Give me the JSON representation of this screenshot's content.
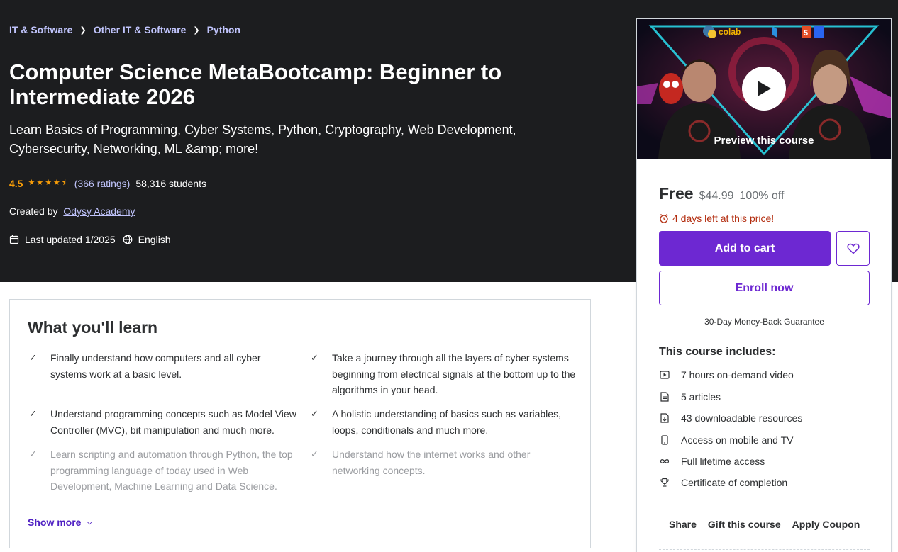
{
  "breadcrumb": [
    "IT & Software",
    "Other IT & Software",
    "Python"
  ],
  "course": {
    "title": "Computer Science MetaBootcamp: Beginner to Intermediate 2026",
    "subtitle": "Learn Basics of Programming, Cyber Systems, Python, Cryptography, Web Development, Cybersecurity, Networking, ML &amp; more!",
    "rating": "4.5",
    "rating_stars": 4.5,
    "ratings_count": "(366 ratings)",
    "students": "58,316 students",
    "created_by_label": "Created by",
    "author": "Odysy Academy",
    "last_updated": "Last updated 1/2025",
    "language": "English"
  },
  "learn": {
    "heading": "What you'll learn",
    "items": [
      "Finally understand how computers and all cyber systems work at a basic level.",
      "Take a journey through all the layers of cyber systems beginning from electrical signals at the bottom up to the algorithms in your head.",
      "Understand programming concepts such as Model View Controller (MVC), bit manipulation and much more.",
      "A holistic understanding of basics such as variables, loops, conditionals and much more.",
      "Learn scripting and automation through Python, the top programming language of today used in Web Development, Machine Learning and Data Science.",
      "Understand how the internet works and other networking concepts."
    ],
    "show_more": "Show more"
  },
  "sidebar": {
    "preview_label": "Preview this course",
    "preview_text": {
      "logo": "colab",
      "badge": "5"
    },
    "price": "Free",
    "original_price": "$44.99",
    "discount": "100% off",
    "timer": "4 days left at this price!",
    "add_to_cart": "Add to cart",
    "enroll": "Enroll now",
    "guarantee": "30-Day Money-Back Guarantee",
    "includes_title": "This course includes:",
    "includes": [
      {
        "icon": "video-icon",
        "text": "7 hours on-demand video"
      },
      {
        "icon": "article-icon",
        "text": "5 articles"
      },
      {
        "icon": "download-icon",
        "text": "43 downloadable resources"
      },
      {
        "icon": "mobile-icon",
        "text": "Access on mobile and TV"
      },
      {
        "icon": "infinity-icon",
        "text": "Full lifetime access"
      },
      {
        "icon": "trophy-icon",
        "text": "Certificate of completion"
      }
    ],
    "links": [
      "Share",
      "Gift this course",
      "Apply Coupon"
    ]
  },
  "colors": {
    "hero_bg": "#1c1d1f",
    "accent": "#6d28d2",
    "link": "#c0c4fc",
    "rating": "#f69c08",
    "timer": "#b32d0f"
  }
}
